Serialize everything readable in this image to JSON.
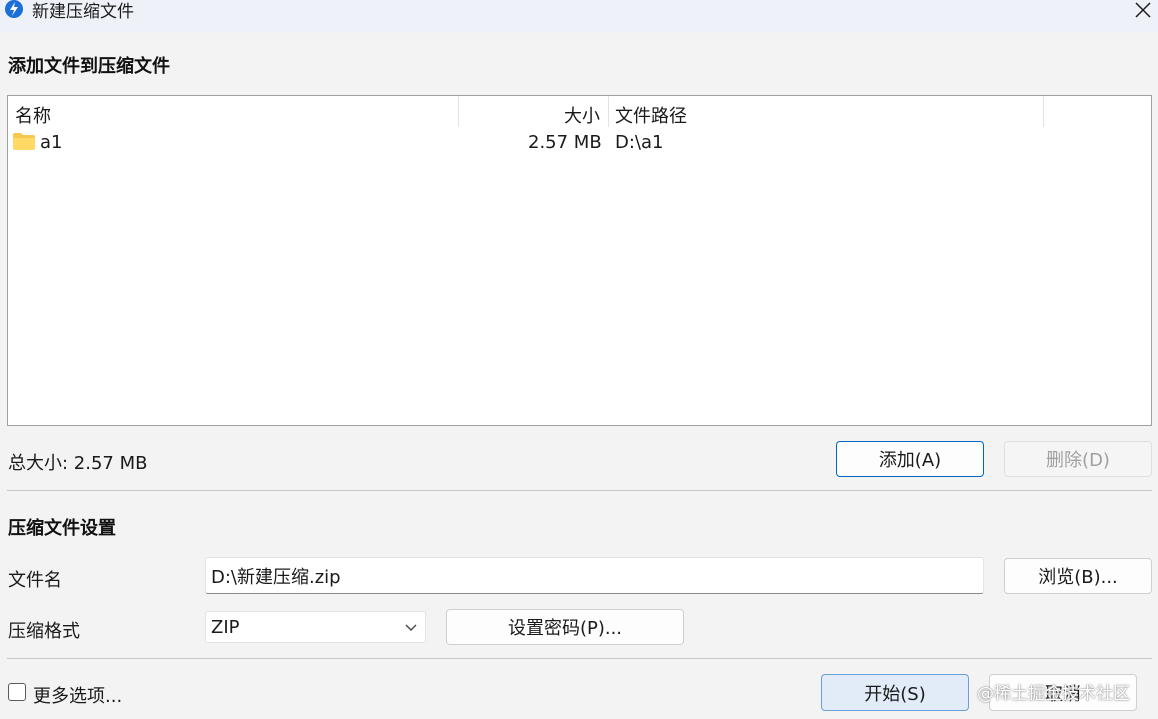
{
  "window": {
    "title": "新建压缩文件",
    "app_icon": "lightning-bolt-icon",
    "close_icon": "close-icon"
  },
  "add_section": {
    "title": "添加文件到压缩文件"
  },
  "file_list": {
    "columns": [
      "名称",
      "大小",
      "文件路径"
    ],
    "rows": [
      {
        "icon": "folder-icon",
        "name": "a1",
        "size": "2.57 MB",
        "path": "D:\\a1"
      }
    ]
  },
  "summary": {
    "total_size": "总大小: 2.57 MB"
  },
  "file_buttons": {
    "add": "添加(A)",
    "delete": "删除(D)"
  },
  "settings": {
    "title": "压缩文件设置",
    "filename_label": "文件名",
    "filename_value": "D:\\新建压缩.zip",
    "browse": "浏览(B)...",
    "format_label": "压缩格式",
    "format_value": "ZIP",
    "set_password": "设置密码(P)..."
  },
  "footer": {
    "more_options": "更多选项...",
    "more_options_checked": false,
    "start": "开始(S)",
    "cancel": "取消"
  },
  "watermark": "@稀土掘金技术社区",
  "colors": {
    "accent": "#0067c0",
    "app_icon": "#1a6fd8",
    "start_bg": "#e1ecf8",
    "folder": "#f6c94e"
  }
}
